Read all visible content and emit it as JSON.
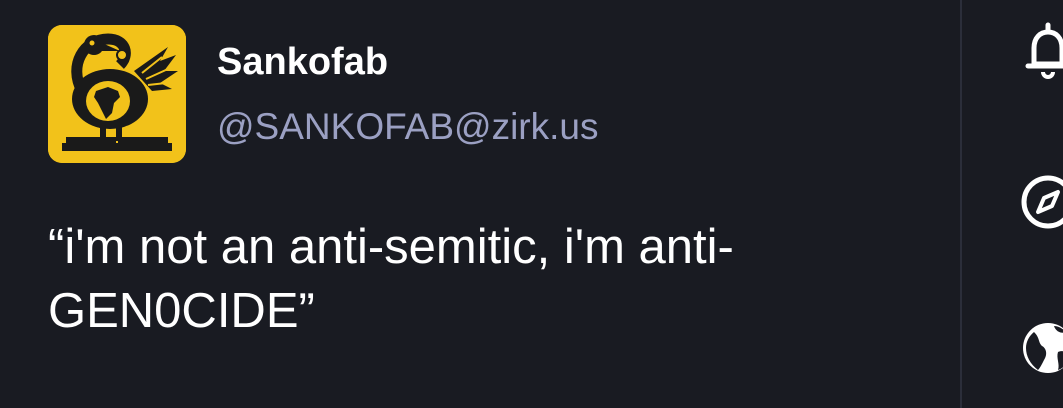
{
  "post": {
    "author": {
      "display_name": "Sankofab",
      "handle": "@SANKOFAB@zirk.us",
      "avatar_bg": "#f2c21a"
    },
    "content": "“i'm not an anti-semitic, i'm anti-GEN0CIDE”"
  },
  "side_nav": {
    "icons": [
      "bell-icon",
      "compass-icon",
      "globe-icon"
    ]
  },
  "colors": {
    "background": "#191b22",
    "handle": "#9ba0c3",
    "text": "#ffffff",
    "divider": "#2b2e3a"
  }
}
